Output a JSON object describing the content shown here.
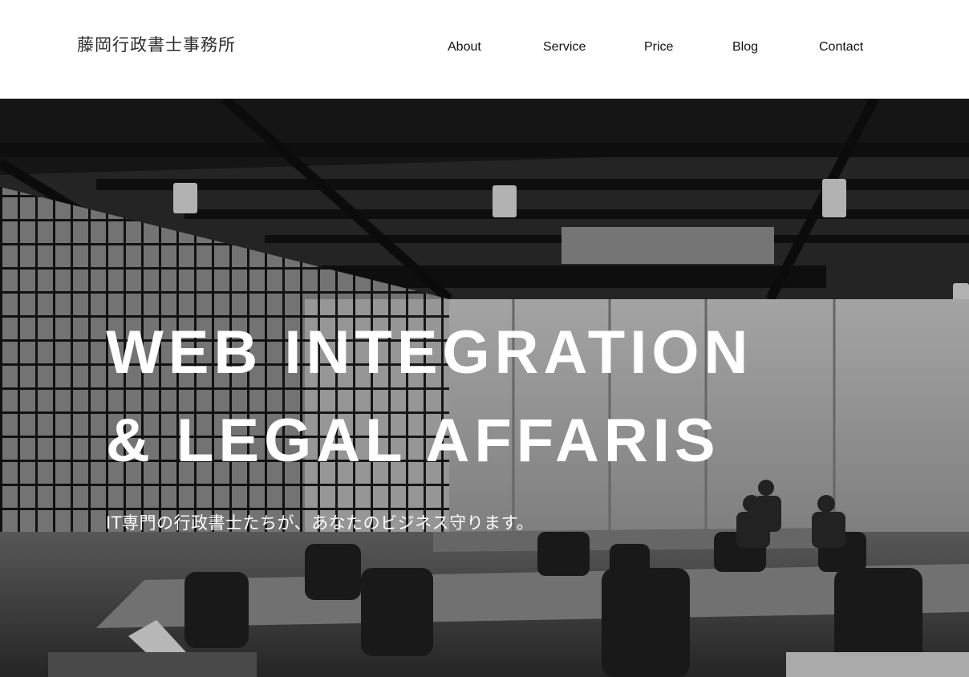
{
  "header": {
    "logo": "藤岡行政書士事務所",
    "nav": {
      "about": "About",
      "service": "Service",
      "price": "Price",
      "blog": "Blog",
      "contact": "Contact"
    }
  },
  "hero": {
    "title_line1": "WEB INTEGRATION",
    "title_line2": "& LEGAL AFFARIS",
    "subtitle": "IT専門の行政書士たちが、あなたのビジネス守ります。",
    "background": "grayscale-office-photo"
  }
}
